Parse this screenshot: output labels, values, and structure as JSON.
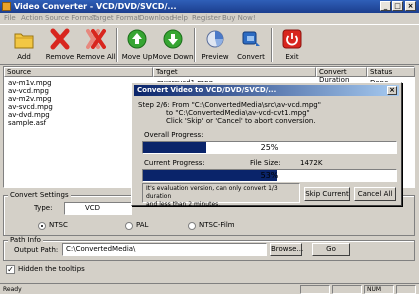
{
  "window": {
    "title": "Video Converter - VCD/DVD/SVCD/..."
  },
  "menu": [
    "File",
    "Action",
    "Source Format",
    "Target Format",
    "Download",
    "Help",
    "Register",
    "Buy Now!"
  ],
  "toolbar": {
    "add": "Add",
    "remove": "Remove",
    "remove_all": "Remove All",
    "move_up": "Move Up",
    "move_down": "Move Down",
    "preview": "Preview",
    "convert": "Convert",
    "exit": "Exit"
  },
  "list": {
    "columns": [
      "Source",
      "Target",
      "Convert Duration",
      "Status"
    ],
    "rows": [
      {
        "source": "av-m1v.mpg",
        "target": "mxsrcvcd1.mpg",
        "status": "Done"
      },
      {
        "source": "av-vcd.mpg",
        "target": "",
        "status": ""
      },
      {
        "source": "av-m2v.mpg",
        "target": "",
        "status": ""
      },
      {
        "source": "av-svcd.mpg",
        "target": "",
        "status": ""
      },
      {
        "source": "av-dvd.mpg",
        "target": "",
        "status": ""
      },
      {
        "source": "sample.asf",
        "target": "",
        "status": ""
      }
    ]
  },
  "settings": {
    "group_label": "Convert Settings",
    "type_label": "Type:",
    "type_value": "VCD",
    "radios": [
      {
        "label": "NTSC",
        "checked": true
      },
      {
        "label": "PAL",
        "checked": false
      },
      {
        "label": "NTSC-Film",
        "checked": false
      }
    ]
  },
  "path": {
    "group_label": "Path Info",
    "output_label": "Output Path:",
    "output_value": "C:\\ConvertedMedia\\",
    "browse": "Browse...",
    "go": "Go"
  },
  "tooltips": {
    "label": "Hidden the tooltips",
    "checked": true
  },
  "status_bar": {
    "text": "Ready",
    "num": "NUM"
  },
  "dialog": {
    "title": "Convert Video to VCD/DVD/SVCD/...",
    "step_lines": [
      "Step 2/6: From \"C:\\ConvertedMedia\\src\\av-vcd.mpg\"",
      "to \"C:\\ConvertedMedia\\av-vcd-cvt1.mpg\"",
      "Click 'Skip' or 'Cancel' to abort conversion."
    ],
    "overall_label": "Overall Progress:",
    "overall_text": "25%",
    "overall_value": 0.25,
    "current_label": "Current Progress:",
    "file_size_label": "File Size:",
    "file_size_value": "1472K",
    "current_text": "53%",
    "current_value": 0.53,
    "notice_lines": [
      "It's evaluation version, can only convert 1/3 duration",
      "and less than 2 minutes."
    ],
    "skip": "Skip Current",
    "cancel": "Cancel All"
  }
}
